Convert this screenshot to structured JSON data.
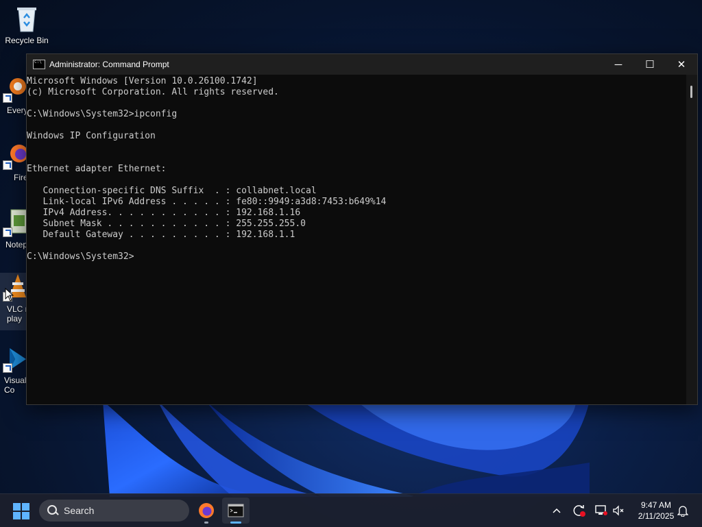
{
  "desktop": {
    "icons": [
      {
        "label": "Recycle Bin",
        "icon": "recycle-bin-icon"
      },
      {
        "label": "Every",
        "icon": "everything-icon"
      },
      {
        "label": "Fire",
        "icon": "firefox-icon"
      },
      {
        "label": "Notep",
        "icon": "notepad-icon"
      },
      {
        "label": "VLC r\nplay",
        "icon": "vlc-icon"
      },
      {
        "label": "Visual\nCo",
        "icon": "vscode-icon"
      }
    ]
  },
  "window": {
    "title": "Administrator: Command Prompt",
    "controls": {
      "minimize": "─",
      "maximize": "☐",
      "close": "✕"
    },
    "console_lines": [
      "Microsoft Windows [Version 10.0.26100.1742]",
      "(c) Microsoft Corporation. All rights reserved.",
      "",
      "C:\\Windows\\System32>ipconfig",
      "",
      "Windows IP Configuration",
      "",
      "",
      "Ethernet adapter Ethernet:",
      "",
      "   Connection-specific DNS Suffix  . : collabnet.local",
      "   Link-local IPv6 Address . . . . . : fe80::9949:a3d8:7453:b649%14",
      "   IPv4 Address. . . . . . . . . . . : 192.168.1.16",
      "   Subnet Mask . . . . . . . . . . . : 255.255.255.0",
      "   Default Gateway . . . . . . . . . : 192.168.1.1",
      "",
      "C:\\Windows\\System32>"
    ]
  },
  "taskbar": {
    "search_label": "Search",
    "time": "9:47 AM",
    "date": "2/11/2025",
    "colors": {
      "accent": "#5fb4ff",
      "console_text": "#cccccc"
    }
  }
}
